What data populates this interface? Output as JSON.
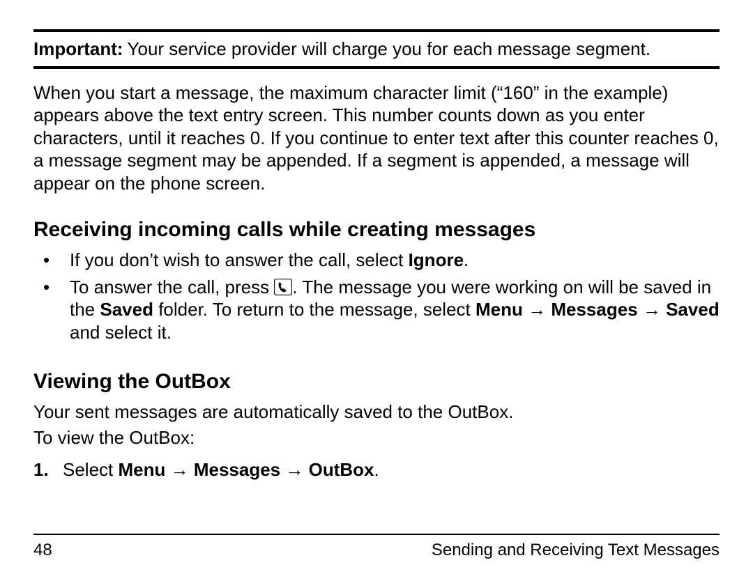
{
  "important": {
    "label": "Important:",
    "text": "Your service provider will charge you for each message segment."
  },
  "intro_paragraph": "When you start a message, the maximum character limit (“160” in the example) appears above the text entry screen. This number counts down as you enter characters, until it reaches 0. If you continue to enter text after this counter reaches 0, a message segment may be appended. If a segment is appended, a message will appear on the phone screen.",
  "section_receiving": {
    "heading": "Receiving incoming calls while creating messages",
    "bullet1_pre": "If you don’t wish to answer the call, select ",
    "bullet1_bold": "Ignore",
    "bullet1_post": ".",
    "bullet2_pre": "To answer the call, press ",
    "bullet2_mid": ". The message you were working on will be saved in the ",
    "bullet2_saved": "Saved",
    "bullet2_mid2": " folder. To return to the message, select ",
    "bullet2_path_menu": "Menu",
    "bullet2_arrow": " → ",
    "bullet2_path_messages": "Messages",
    "bullet2_path_saved": "Saved",
    "bullet2_post": " and select it."
  },
  "section_outbox": {
    "heading": "Viewing the OutBox",
    "p1": "Your sent messages are automatically saved to the OutBox.",
    "p2": "To view the OutBox:",
    "step1_num": "1.",
    "step1_pre": "Select ",
    "step1_menu": "Menu",
    "step1_arrow": " → ",
    "step1_messages": "Messages",
    "step1_outbox": "OutBox",
    "step1_post": "."
  },
  "footer": {
    "page_number": "48",
    "title": "Sending and Receiving Text Messages"
  }
}
